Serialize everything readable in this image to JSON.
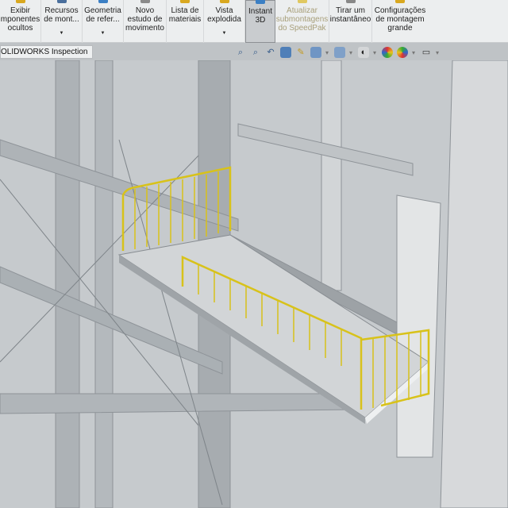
{
  "ribbon": {
    "buttons": [
      {
        "label": "Exibir\ncomponentes\nocultos",
        "text": "Exibir\nmponentes\nocultos",
        "dropdown": false
      },
      {
        "label": "Recursos\nde mont...",
        "dropdown": true
      },
      {
        "label": "Geometria\nde refer...",
        "dropdown": true
      },
      {
        "label": "Novo\nestudo de\nmovimento",
        "dropdown": false
      },
      {
        "label": "Lista de\nmateriais",
        "dropdown": false
      },
      {
        "label": "Vista\nexplodida",
        "dropdown": true
      },
      {
        "label": "Instant\n3D",
        "active": true
      },
      {
        "label": "Atualizar\nsubmontagens\ndo SpeedPak",
        "disabled": true
      },
      {
        "label": "Tirar um\ninstantâneo"
      },
      {
        "label": "Configurações\nde montagem\ngrande"
      }
    ]
  },
  "tab": {
    "label": "OLIDWORKS Inspection"
  },
  "view_toolbar": {
    "icons": [
      "zoom-to-fit-icon",
      "zoom-area-icon",
      "previous-view-icon",
      "section-view-icon",
      "dynamic-annotation-icon",
      "view-orientation-icon",
      "display-style-icon",
      "hide-show-items-icon",
      "edit-appearance-icon",
      "apply-scene-icon",
      "view-settings-icon"
    ]
  },
  "colors": {
    "railing": "#d8c21a",
    "structure": "#9ea3a8",
    "background": "#c8ccd0"
  }
}
